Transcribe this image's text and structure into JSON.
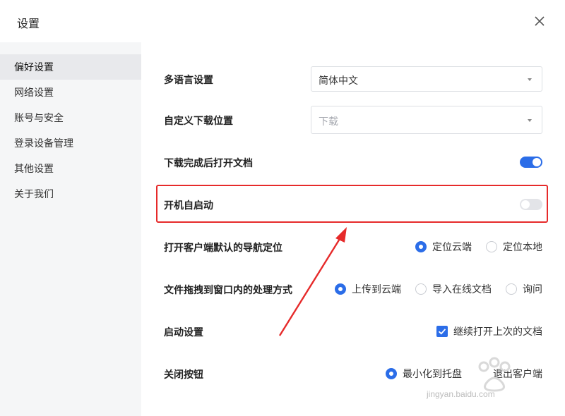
{
  "window": {
    "title": "设置"
  },
  "sidebar": {
    "items": [
      {
        "label": "偏好设置",
        "active": true
      },
      {
        "label": "网络设置"
      },
      {
        "label": "账号与安全"
      },
      {
        "label": "登录设备管理"
      },
      {
        "label": "其他设置"
      },
      {
        "label": "关于我们"
      }
    ]
  },
  "settings": {
    "language": {
      "label": "多语言设置",
      "value": "简体中文"
    },
    "download_location": {
      "label": "自定义下载位置",
      "placeholder": "下载"
    },
    "open_after_download": {
      "label": "下载完成后打开文档",
      "enabled": true
    },
    "auto_start": {
      "label": "开机自启动",
      "enabled": false
    },
    "default_nav": {
      "label": "打开客户端默认的导航定位",
      "options": [
        "定位云端",
        "定位本地"
      ],
      "selected": "定位云端"
    },
    "drag_behavior": {
      "label": "文件拖拽到窗口内的处理方式",
      "options": [
        "上传到云端",
        "导入在线文档",
        "询问"
      ],
      "selected": "上传到云端"
    },
    "startup": {
      "label": "启动设置",
      "checkbox": "继续打开上次的文档",
      "checked": true
    },
    "close_button": {
      "label": "关闭按钮",
      "options": [
        "最小化到托盘",
        "退出客户端"
      ],
      "selected": "最小化到托盘"
    }
  },
  "watermark": {
    "text": "jingyan.baidu.com"
  },
  "colors": {
    "accent": "#2b6de8",
    "highlight": "#e62a2a",
    "sidebar_bg": "#f5f6f7"
  }
}
